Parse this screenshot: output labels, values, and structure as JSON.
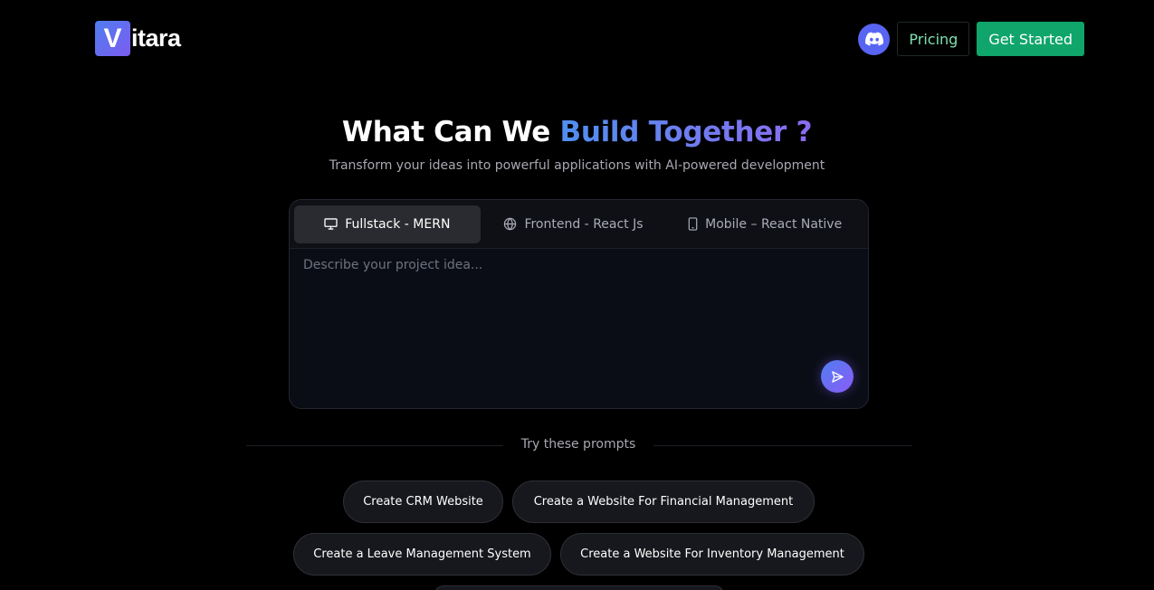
{
  "header": {
    "logo_letter": "V",
    "logo_text": "itara",
    "pricing_label": "Pricing",
    "get_started_label": "Get Started",
    "discord_icon": "discord-icon"
  },
  "hero": {
    "title_plain": "What Can We ",
    "title_highlight": "Build Together ?",
    "subtitle": "Transform your ideas into powerful applications with AI-powered development"
  },
  "prompt_card": {
    "tabs": [
      {
        "label": "Fullstack - MERN",
        "icon": "monitor-icon",
        "active": true
      },
      {
        "label": "Frontend - React Js",
        "icon": "globe-icon",
        "active": false
      },
      {
        "label": "Mobile – React Native",
        "icon": "smartphone-icon",
        "active": false
      }
    ],
    "placeholder": "Describe your project idea...",
    "value": ""
  },
  "suggestions": {
    "heading": "Try these prompts",
    "chips": [
      "Create CRM Website",
      "Create a Website For Financial Management",
      "Create a Leave Management System",
      "Create a Website For Inventory Management"
    ]
  },
  "colors": {
    "background": "#000000",
    "accent_blue": "#4f8ff0",
    "accent_purple": "#8b6cf0",
    "cta_green": "#10a56a",
    "discord": "#5865f2"
  }
}
